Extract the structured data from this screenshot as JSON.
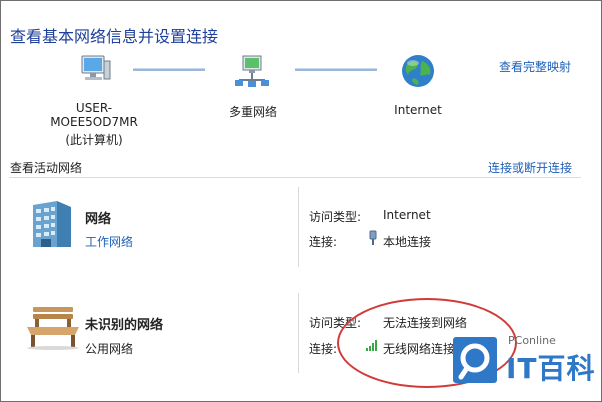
{
  "window": {
    "title": "查看基本网络信息并设置连接"
  },
  "links": {
    "full_map": "查看完整映射",
    "connect_disconnect": "连接或断开连接"
  },
  "map": {
    "computer": {
      "name": "USER-MOEE5OD7MR",
      "sub": "(此计算机)"
    },
    "multi": {
      "name": "多重网络"
    },
    "internet": {
      "name": "Internet"
    }
  },
  "active_networks": {
    "heading": "查看活动网络",
    "items": [
      {
        "name": "网络",
        "type": "工作网络",
        "access_label": "访问类型:",
        "access_value": "Internet",
        "connection_label": "连接:",
        "connection_value": "本地连接",
        "icon": "building-network-icon"
      },
      {
        "name": "未识别的网络",
        "type": "公用网络",
        "access_label": "访问类型:",
        "access_value": "无法连接到网络",
        "connection_label": "连接:",
        "connection_value": "无线网络连接",
        "icon": "park-bench-icon"
      }
    ]
  },
  "watermark": {
    "small": "PConline",
    "big": "IT百科"
  },
  "colors": {
    "link": "#1f5fb8",
    "title": "#1e3f9a",
    "annotation": "#d23a3a",
    "brand": "#2f78c7"
  }
}
